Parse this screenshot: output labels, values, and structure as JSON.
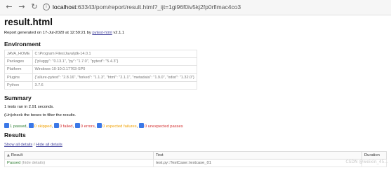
{
  "browser": {
    "url_host": "localhost",
    "url_path": ":63343/pom/report/result.html?_ijt=1gi96f0iv5kj2fp0rflmac4co3",
    "back_glyph": "←",
    "forward_glyph": "→",
    "reload_glyph": "↻",
    "info_glyph": "i"
  },
  "report": {
    "title": "result.html",
    "generated_prefix": "Report generated on 17-Jul-2020 at 12:59:21 by ",
    "generated_link": "pytest-html",
    "generated_version": " v2.1.1"
  },
  "environment": {
    "heading": "Environment",
    "rows": [
      {
        "key": "JAVA_HOME",
        "value": "C:\\Program Files\\Java\\jdk-14.0.1"
      },
      {
        "key": "Packages",
        "value": "{\"pluggy\": \"0.13.1\", \"py\": \"1.7.0\", \"pytest\": \"5.4.3\"}"
      },
      {
        "key": "Platform",
        "value": "Windows-10-10.0.17763-SP0"
      },
      {
        "key": "Plugins",
        "value": "{\"allure-pytest\": \"2.8.16\", \"forked\": \"1.1.3\", \"html\": \"2.1.1\", \"metadata\": \"1.9.0\", \"xdist\": \"1.32.0\"}"
      },
      {
        "key": "Python",
        "value": "3.7.6"
      }
    ]
  },
  "summary": {
    "heading": "Summary",
    "tests_ran": "1 tests ran in 2.91 seconds.",
    "filter_hint": "(Un)check the boxes to filter the results.",
    "filters": {
      "passed": "1 passed",
      "skipped": "0 skipped",
      "failed": "0 failed",
      "errors": "0 errors",
      "xfail": "0 expected failures",
      "xpass": "0 unexpected passes"
    },
    "sep": ", "
  },
  "results": {
    "heading": "Results",
    "show_all": "Show all details",
    "divider": " / ",
    "hide_all": "Hide all details",
    "columns": {
      "result": "Result",
      "test": "Test",
      "duration": "Duration"
    },
    "sort_glyph": "▲",
    "rows": [
      {
        "result": "Passed",
        "details": "(hide details)",
        "test": "test.py::TestCase::testcase_01",
        "duration": ""
      }
    ]
  },
  "watermark": "CSDN @weixin_45..."
}
